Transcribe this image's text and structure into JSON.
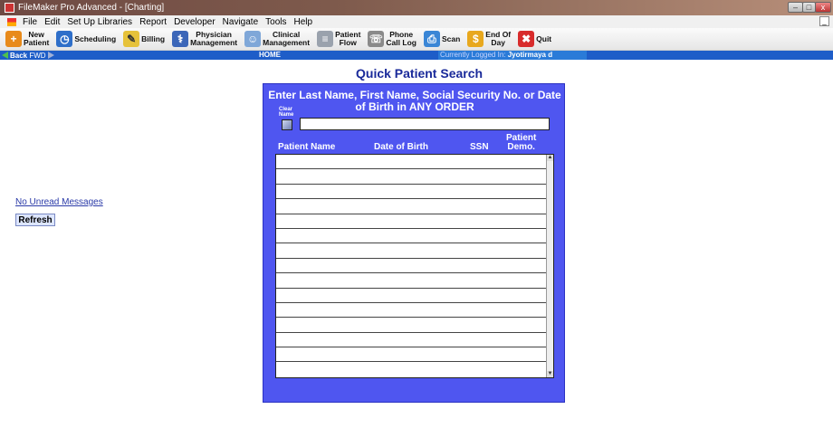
{
  "window": {
    "title": "FileMaker Pro Advanced - [Charting]"
  },
  "menu": [
    "File",
    "Edit",
    "Set Up Libraries",
    "Report",
    "Developer",
    "Navigate",
    "Tools",
    "Help"
  ],
  "toolbar": {
    "new_patient": "New\nPatient",
    "scheduling": "Scheduling",
    "billing": "Billing",
    "physician_management": "Physician\nManagement",
    "clinical_management": "Clinical\nManagement",
    "patient_flow": "Patient\nFlow",
    "phone_call_log": "Phone\nCall Log",
    "scan": "Scan",
    "end_of_day": "End Of\nDay",
    "quit": "Quit"
  },
  "navbar": {
    "back": "Back",
    "fwd": "FWD",
    "location": "HOME",
    "logged_label": "Currently Logged In:",
    "logged_user": "Jyotirmaya d"
  },
  "left": {
    "messages_link": "No Unread Messages",
    "refresh": "Refresh"
  },
  "search": {
    "title": "Quick Patient Search",
    "instructions": "Enter Last Name, First Name, Social Security No. or Date of Birth in ANY ORDER",
    "clear_label": "Clear Name",
    "input_value": ""
  },
  "columns": {
    "name": "Patient Name",
    "dob": "Date of Birth",
    "ssn": "SSN",
    "demo": "Patient\nDemo."
  },
  "colors": {
    "panel": "#4f56f0",
    "nav": "#1e5dc8",
    "title": "#1a2a9a"
  }
}
